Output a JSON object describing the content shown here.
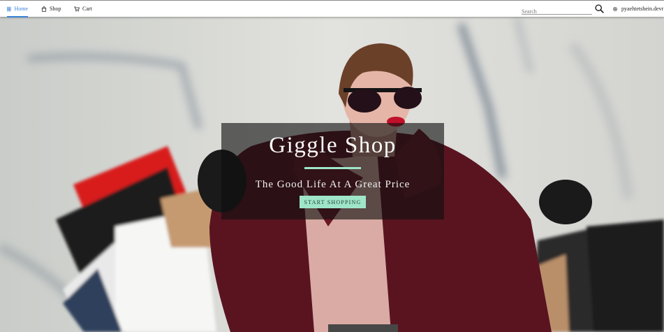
{
  "nav": {
    "home_label": "Home",
    "shop_label": "Shop",
    "cart_label": "Cart",
    "active": "home",
    "accent_color": "#3b82d6"
  },
  "search": {
    "placeholder": "Search",
    "value": ""
  },
  "user": {
    "name": "pyaehtetshein.devr"
  },
  "hero": {
    "title": "Giggle Shop",
    "subtitle": "The Good Life At A Great Price",
    "cta_label": "START SHOPPING",
    "accent_color": "#9fe6c9",
    "image": "woman-with-shopping-bags"
  },
  "icons": {
    "home": "grid-icon",
    "shop": "shopping-bag-icon",
    "cart": "cart-icon",
    "search": "search-icon",
    "user": "gear-icon"
  }
}
